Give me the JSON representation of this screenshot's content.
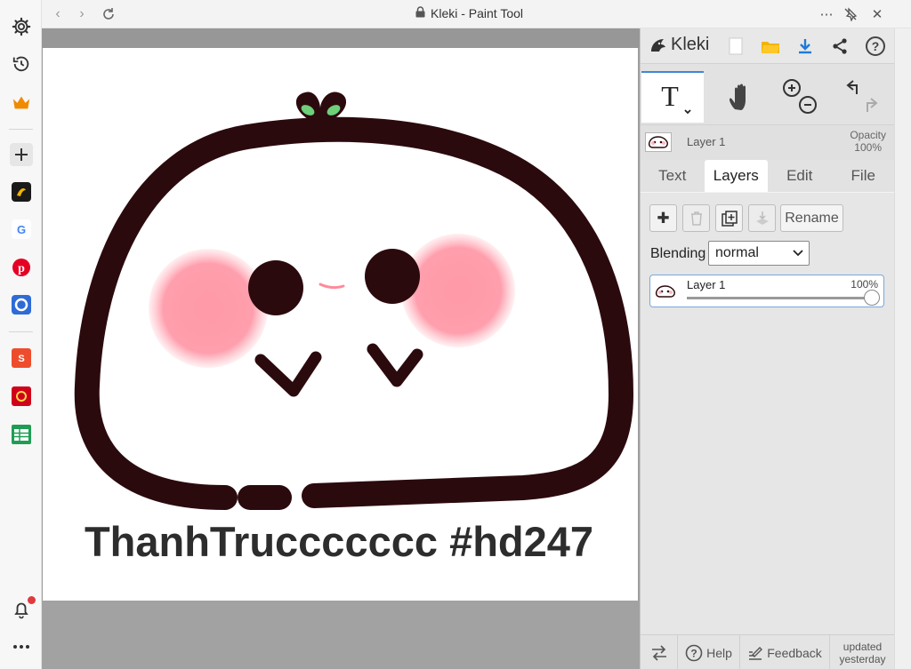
{
  "window": {
    "title": "Kleki - Paint Tool"
  },
  "browser_sidebar": {
    "items": [
      "gear-icon",
      "history-icon",
      "crown-icon",
      "add-icon",
      "app-dark-icon",
      "google-icon",
      "pinterest-icon",
      "blue-app-icon",
      "shopee-icon",
      "red-app-icon",
      "sheets-icon",
      "bell-icon",
      "more-icon"
    ]
  },
  "canvas": {
    "caption": "ThanhTruccccccc #hd247"
  },
  "panel": {
    "brand": "Kleki",
    "layer_info": {
      "name": "Layer 1",
      "opacity_label": "Opacity",
      "opacity_value": "100%"
    },
    "tabs": [
      "Text",
      "Layers",
      "Edit",
      "File"
    ],
    "active_tab": "Layers",
    "rename_label": "Rename",
    "blending_label": "Blending",
    "blending_value": "normal",
    "layer_card": {
      "name": "Layer 1",
      "percent": "100%",
      "opacity_fraction": 1.0
    },
    "footer": {
      "help": "Help",
      "feedback": "Feedback",
      "updated_line1": "updated",
      "updated_line2": "yesterday"
    }
  },
  "colors": {
    "accent": "#3f87d8",
    "outline": "#2b0a0e",
    "blush": "#ff9aa8"
  }
}
